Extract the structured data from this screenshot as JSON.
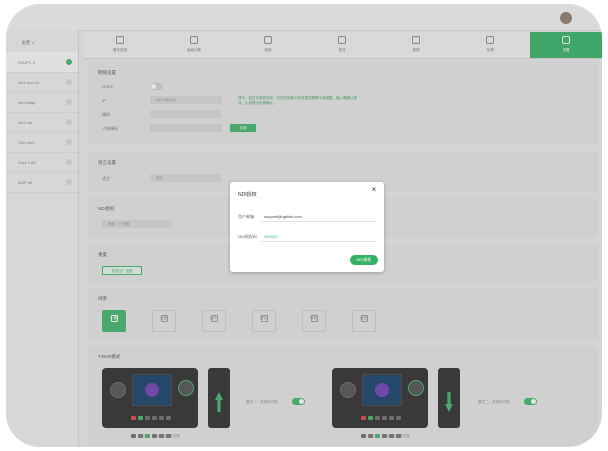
{
  "sidebar": {
    "header": "配置 ∨",
    "items": [
      {
        "label": "RAVPC 2",
        "active": true
      },
      {
        "label": "mini ano V2",
        "active": false
      },
      {
        "label": "mini edge",
        "active": false
      },
      {
        "label": "mini mix",
        "active": false
      },
      {
        "label": "TAO mini",
        "active": false
      },
      {
        "label": "Sree 4 AE",
        "active": false
      },
      {
        "label": "MAP 4K",
        "active": false
      }
    ]
  },
  "tabs": [
    {
      "label": "基本信息",
      "icon": "info-icon"
    },
    {
      "label": "画面切换",
      "icon": "grid-icon"
    },
    {
      "label": "录制",
      "icon": "record-icon"
    },
    {
      "label": "推流",
      "icon": "stream-icon"
    },
    {
      "label": "音频",
      "icon": "music-icon"
    },
    {
      "label": "存储",
      "icon": "folder-icon"
    },
    {
      "label": "设置",
      "icon": "settings-icon",
      "active": true
    }
  ],
  "network": {
    "title": "网络设置",
    "dhcp_label": "DHCP",
    "ip_label": "IP",
    "ip_value": "192.168.0.21",
    "mask_label": "掩码",
    "gateway_label": "子网掩码",
    "note": "提示：如在记录服务前，仅在初始数字化设置或需要中继调整，输入需确认更改，生成提示如需确认。",
    "apply_label": "应用"
  },
  "language": {
    "title": "语言设置",
    "label": "语言",
    "value": "中文"
  },
  "ndi_section": {
    "title": "NDI授权",
    "status": "授权：已开通"
  },
  "reset": {
    "title": "重置",
    "button": "恢复出厂设置"
  },
  "scenes": {
    "title": "场景",
    "items": [
      {
        "label": "一键",
        "active": true
      },
      {
        "label": "分屏",
        "active": false
      },
      {
        "label": "画中",
        "active": false
      },
      {
        "label": "预设",
        "active": false
      },
      {
        "label": "录制",
        "active": false
      },
      {
        "label": "返回",
        "active": false
      }
    ]
  },
  "tbar": {
    "title": "T-BAR模式",
    "left_toggle_label": "模式一：开启时切换",
    "right_toggle_label": "模式二：开启时切换",
    "left_caption": "模式一：T-BAR推到底切换",
    "right_caption": "模式二：T-BAR推到底切换"
  },
  "modal": {
    "title": "NDI授权",
    "close": "×",
    "email_label": "用户邮箱",
    "email_value": "support@rgblink.com",
    "code_label": "NDI授权码",
    "code_value": "NDI002",
    "submit": "NDI授权"
  },
  "colors": {
    "accent": "#35b166",
    "background": "#e8e8e8"
  }
}
